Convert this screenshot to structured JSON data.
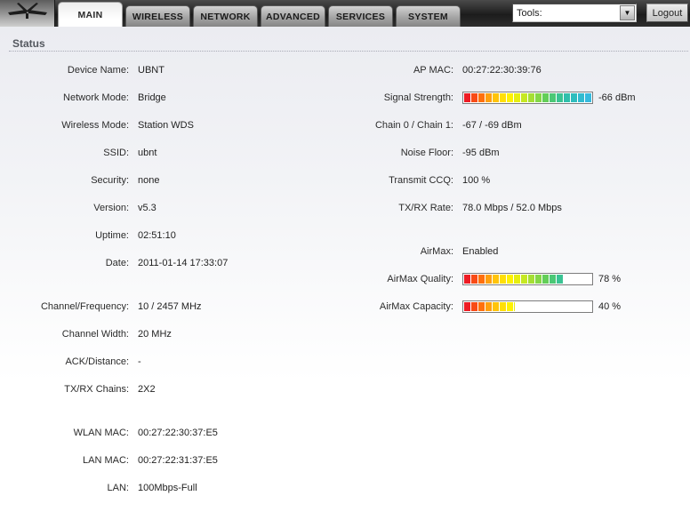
{
  "header": {
    "logo_icon": "ubiquiti-antenna-logo",
    "tabs": [
      {
        "label": "MAIN",
        "active": true
      },
      {
        "label": "WIRELESS",
        "active": false
      },
      {
        "label": "NETWORK",
        "active": false
      },
      {
        "label": "ADVANCED",
        "active": false
      },
      {
        "label": "SERVICES",
        "active": false
      },
      {
        "label": "SYSTEM",
        "active": false
      }
    ],
    "tools_select": {
      "value": "Tools:"
    },
    "logout_button": "Logout"
  },
  "status": {
    "section_title": "Status",
    "left_groups": [
      [
        {
          "label": "Device Name:",
          "value": "UBNT"
        },
        {
          "label": "Network Mode:",
          "value": "Bridge"
        },
        {
          "label": "Wireless Mode:",
          "value": "Station WDS"
        },
        {
          "label": "SSID:",
          "value": "ubnt"
        },
        {
          "label": "Security:",
          "value": "none"
        },
        {
          "label": "Version:",
          "value": "v5.3"
        },
        {
          "label": "Uptime:",
          "value": "02:51:10"
        },
        {
          "label": "Date:",
          "value": "2011-01-14 17:33:07"
        }
      ],
      [
        {
          "label": "Channel/Frequency:",
          "value": "10 / 2457 MHz"
        },
        {
          "label": "Channel Width:",
          "value": "20 MHz"
        },
        {
          "label": "ACK/Distance:",
          "value": "-"
        },
        {
          "label": "TX/RX Chains:",
          "value": "2X2"
        }
      ],
      [
        {
          "label": "WLAN MAC:",
          "value": "00:27:22:30:37:E5"
        },
        {
          "label": "LAN MAC:",
          "value": "00:27:22:31:37:E5"
        },
        {
          "label": "LAN:",
          "value": "100Mbps-Full"
        }
      ]
    ],
    "right_groups": [
      [
        {
          "label": "AP MAC:",
          "value": "00:27:22:30:39:76"
        },
        {
          "label": "Signal Strength:",
          "type": "bar",
          "name": "signal-strength",
          "percent": 100,
          "value": "-66 dBm"
        },
        {
          "label": "Chain 0 / Chain 1:",
          "value": "-67 / -69 dBm"
        },
        {
          "label": "Noise Floor:",
          "value": "-95 dBm"
        },
        {
          "label": "Transmit CCQ:",
          "value": "100 %"
        },
        {
          "label": "TX/RX Rate:",
          "value": "78.0 Mbps / 52.0 Mbps"
        }
      ],
      [
        {
          "label": "AirMax:",
          "value": "Enabled"
        },
        {
          "label": "AirMax Quality:",
          "type": "bar",
          "name": "airmax-quality",
          "percent": 78,
          "value": "78 %"
        },
        {
          "label": "AirMax Capacity:",
          "type": "bar",
          "name": "airmax-capacity",
          "percent": 40,
          "value": "40 %"
        }
      ]
    ],
    "meter": {
      "segment_count": 18,
      "ramp": [
        "#ed1c24",
        "#f84b16",
        "#ff700d",
        "#ffa00e",
        "#ffc40a",
        "#ffdf06",
        "#fef102",
        "#e6ef10",
        "#c6e822",
        "#a5df34",
        "#84d746",
        "#63ce58",
        "#4bc876",
        "#3ac393",
        "#30bfab",
        "#2fbdbd",
        "#32bbcf",
        "#36bade"
      ]
    }
  },
  "colors": {
    "topbar": "#1c1c1c",
    "content_bg_top": "#ebecf1",
    "meter_border": "#7d7d7d",
    "title_text": "#54585f"
  }
}
